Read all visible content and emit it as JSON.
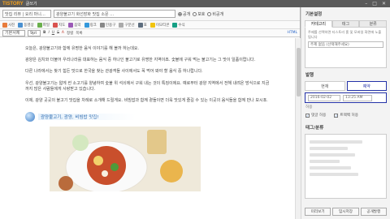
{
  "window": {
    "logo": "TISTORY",
    "title": "글쓰기"
  },
  "editor": {
    "category_select": "맛집 리뷰 | 요리 마니…",
    "post_title": "광양불고기 화선장화 맛집 소문 …",
    "alignment": [
      {
        "label": "공개",
        "selected": true
      },
      {
        "label": "보호",
        "selected": false
      },
      {
        "label": "비공개",
        "selected": false
      }
    ],
    "toolbar_row2": [
      "사진",
      "동영상",
      "파일",
      "지도",
      "음악",
      "링크",
      "인용구",
      "구분선",
      "표",
      "이모티콘",
      "수식"
    ],
    "toolbar_row3": [
      "기본서체",
      "9pt",
      "B",
      "I",
      "U",
      "S",
      "A",
      "정렬",
      "목록",
      "HTML"
    ],
    "paragraphs": [
      "오늘은, 광양불고기와 함께 유명한 음식 이야기를 해 볼까 하는데요.",
      "광양은 김치와 더불어 우리나라를 대표하는 음식 중 하나인 불고기로 유명한 지역이죠. 숯불에 구워 먹는 불고기는 그 맛이 일품이랍니다.",
      "다른 나라에서는 찾기 힘든 맛으로 한국을 찾는 관광객들 사이에서도 꼭 먹어 봐야 할 음식 중 하나랍니다.",
      "우선, 광양불고기는 얇게 썬 소고기를 양념하여 숯불 위 석쇠에서 구워 내는 것이 특징이에요. 예로부터 광양 지역에서 전해 내려온 방식으로 지금까지 많은 사람들에게 사랑받고 있습니다.",
      "이제, 광양 곳곳의 불고기 맛집을 차례로 소개해 드릴게요. 비빔밥과 함께 곁들이면 더욱 맛있게 즐길 수 있는 이곳의 음식들을 함께 만나 보시죠."
    ],
    "quote_title": "광양불고기, 광양, 비빔밥 맛집!"
  },
  "sidebar": {
    "section1": "기본설정",
    "tabs": [
      "카테고리",
      "태그",
      "분류"
    ],
    "hint": "주제를 선택하면 티스토리 홈 및 모바일 화면에 노출됩니다",
    "topic_select": "주제 없음 (선택해주세요)",
    "section2": "발행",
    "publish_options": [
      {
        "label": "현재",
        "selected": false
      },
      {
        "label": "예약",
        "selected": true
      }
    ],
    "date": "2016-02-02",
    "time": "13:25 AM",
    "allow_label": "허용",
    "comments": "댓글 허용",
    "trackback": "트랙백 허용",
    "section3": "태그/분류",
    "buttons": [
      "미리보기",
      "임시저장",
      "공개발행"
    ]
  },
  "colors": {
    "accent": "#2432a8",
    "brand": "#f7a21b"
  }
}
